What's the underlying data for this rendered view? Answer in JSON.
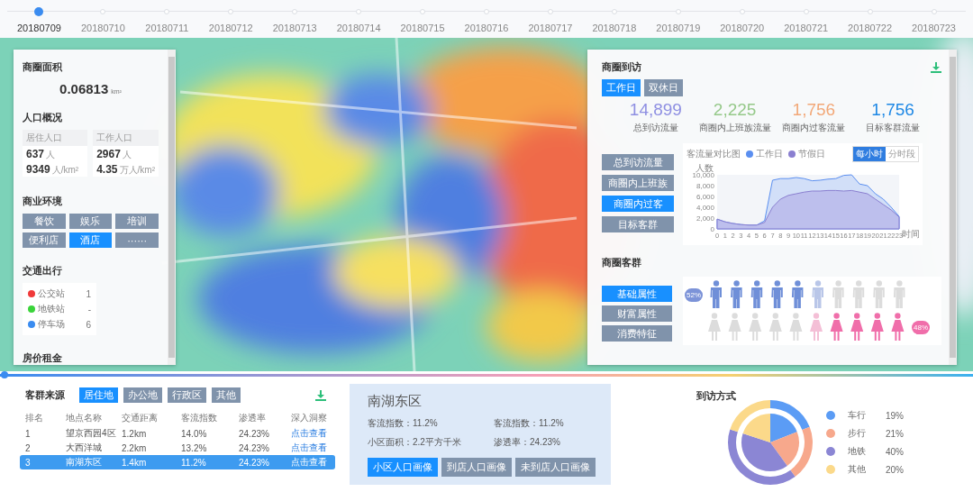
{
  "timeline": {
    "dates": [
      {
        "label": "20180709",
        "selected": true
      },
      {
        "label": "20180710",
        "selected": false
      },
      {
        "label": "20180711",
        "selected": false
      },
      {
        "label": "20180712",
        "selected": false
      },
      {
        "label": "20180713",
        "selected": false
      },
      {
        "label": "20180714",
        "selected": false
      },
      {
        "label": "20180715",
        "selected": false
      },
      {
        "label": "20180716",
        "selected": false
      },
      {
        "label": "20180717",
        "selected": false
      },
      {
        "label": "20180718",
        "selected": false
      },
      {
        "label": "20180719",
        "selected": false
      },
      {
        "label": "20180720",
        "selected": false
      },
      {
        "label": "20180721",
        "selected": false
      },
      {
        "label": "20180722",
        "selected": false
      },
      {
        "label": "20180723",
        "selected": false
      }
    ]
  },
  "area_panel": {
    "title": "商圈面积",
    "value": "0.06813",
    "unit": "km²",
    "population": {
      "title": "人口概况",
      "cards": [
        {
          "label": "居住人口",
          "count": "637",
          "count_unit": "人",
          "density": "9349",
          "density_unit": "人/km²"
        },
        {
          "label": "工作人口",
          "count": "2967",
          "count_unit": "人",
          "density": "4.35",
          "density_unit": "万人/km²"
        }
      ]
    },
    "business": {
      "title": "商业环境",
      "tags": [
        {
          "label": "餐饮",
          "selected": false
        },
        {
          "label": "娱乐",
          "selected": false
        },
        {
          "label": "培训",
          "selected": false
        },
        {
          "label": "便利店",
          "selected": false
        },
        {
          "label": "酒店",
          "selected": true
        },
        {
          "label": "······",
          "selected": false
        }
      ]
    },
    "transport": {
      "title": "交通出行",
      "items": [
        {
          "label": "公交站",
          "count": "1",
          "color": "#f03a3a"
        },
        {
          "label": "地铁站",
          "count": "-",
          "color": "#3ad43a"
        },
        {
          "label": "停车场",
          "count": "6",
          "color": "#3a8cf0"
        }
      ]
    },
    "housing": {
      "title": "房价租金"
    }
  },
  "visit_panel": {
    "title": "商圈到访",
    "day_tabs": [
      {
        "label": "工作日",
        "selected": true
      },
      {
        "label": "双休日",
        "selected": false
      }
    ],
    "stats": [
      {
        "value": "14,899",
        "label": "总到访流量",
        "color": "#8e8fe2"
      },
      {
        "value": "2,225",
        "label": "商圈内上班族流量",
        "color": "#96c98a"
      },
      {
        "value": "1,756",
        "label": "商圈内过客流量",
        "color": "#f2a878"
      },
      {
        "value": "1,756",
        "label": "目标客群流量",
        "color": "#1e88e5"
      }
    ],
    "flow_buttons": [
      {
        "label": "总到访流量",
        "selected": false
      },
      {
        "label": "商圈内上班族",
        "selected": false
      },
      {
        "label": "商圈内过客",
        "selected": true
      },
      {
        "label": "目标客群",
        "selected": false
      }
    ],
    "chart": {
      "modes": [
        {
          "label": "每小时",
          "selected": true
        },
        {
          "label": "分时段",
          "selected": false
        }
      ],
      "chart_data": {
        "type": "area",
        "title": "客流量对比图",
        "xlabel": "时间",
        "ylabel": "人数",
        "x": [
          0,
          1,
          2,
          3,
          4,
          5,
          6,
          7,
          8,
          9,
          10,
          11,
          12,
          13,
          14,
          15,
          16,
          17,
          18,
          19,
          20,
          21,
          22,
          23
        ],
        "series": [
          {
            "name": "工作日",
            "color": "#5b8ff0",
            "values": [
              1800,
              1300,
              1000,
              800,
              700,
              700,
              1500,
              9000,
              9300,
              9300,
              9500,
              9300,
              8900,
              9000,
              9200,
              9300,
              9900,
              10000,
              8300,
              8000,
              6500,
              5500,
              4000,
              2300
            ]
          },
          {
            "name": "节假日",
            "color": "#8a7fd0",
            "values": [
              1800,
              1300,
              1000,
              800,
              700,
              700,
              1200,
              4000,
              5500,
              6200,
              6500,
              6800,
              7000,
              7000,
              7100,
              7100,
              7000,
              7100,
              6800,
              6500,
              5500,
              4500,
              3500,
              2200
            ]
          }
        ],
        "xlim": [
          0,
          23
        ],
        "ylim": [
          0,
          10000
        ],
        "yticks": [
          {
            "value": 0,
            "label": "0"
          },
          {
            "value": 2000,
            "label": "2,000"
          },
          {
            "value": 4000,
            "label": "4,000"
          },
          {
            "value": 6000,
            "label": "6,000"
          },
          {
            "value": 8000,
            "label": "8,000"
          },
          {
            "value": 10000,
            "label": "10,000"
          }
        ],
        "xticks": [
          0,
          1,
          2,
          3,
          4,
          5,
          6,
          7,
          8,
          9,
          10,
          11,
          12,
          13,
          14,
          15,
          16,
          17,
          18,
          19,
          20,
          21,
          22,
          23
        ]
      }
    },
    "crowd": {
      "title": "商圈客群",
      "buttons": [
        {
          "label": "基础属性",
          "selected": true
        },
        {
          "label": "财富属性",
          "selected": false
        },
        {
          "label": "消费特征",
          "selected": false
        }
      ],
      "male": {
        "badge": "52%",
        "figures": [
          {
            "kind": "full"
          },
          {
            "kind": "full"
          },
          {
            "kind": "full"
          },
          {
            "kind": "full"
          },
          {
            "kind": "full"
          },
          {
            "kind": "faded"
          },
          {
            "kind": "empty"
          },
          {
            "kind": "empty"
          },
          {
            "kind": "empty"
          },
          {
            "kind": "empty"
          }
        ]
      },
      "female": {
        "badge": "48%",
        "figures": [
          {
            "kind": "empty"
          },
          {
            "kind": "empty"
          },
          {
            "kind": "empty"
          },
          {
            "kind": "empty"
          },
          {
            "kind": "empty"
          },
          {
            "kind": "faded"
          },
          {
            "kind": "full"
          },
          {
            "kind": "full"
          },
          {
            "kind": "full"
          },
          {
            "kind": "full"
          }
        ]
      }
    }
  },
  "source": {
    "title": "客群来源",
    "tabs": [
      {
        "label": "居住地",
        "selected": true
      },
      {
        "label": "办公地",
        "selected": false
      },
      {
        "label": "行政区",
        "selected": false
      },
      {
        "label": "其他",
        "selected": false
      }
    ],
    "table": {
      "columns": [
        "排名",
        "地点名称",
        "交通距离",
        "客流指数",
        "渗透率",
        "深入洞察"
      ],
      "rows": [
        {
          "cells": [
            "1",
            "望京西园4区",
            "1.2km",
            "14.0%",
            "24.23%"
          ],
          "link": "点击查看",
          "selected": false
        },
        {
          "cells": [
            "2",
            "大西洋城",
            "2.2km",
            "13.2%",
            "24.23%"
          ],
          "link": "点击查看",
          "selected": false
        },
        {
          "cells": [
            "3",
            "南湖东区",
            "1.4km",
            "11.2%",
            "24.23%"
          ],
          "link": "点击查看",
          "selected": true
        }
      ]
    }
  },
  "popup": {
    "title": "南湖东区",
    "facts": [
      "客流指数：11.2%",
      "客流指数：11.2%",
      "小区面积：2.2平方千米",
      "渗透率：24.23%"
    ],
    "buttons": [
      {
        "label": "小区人口画像",
        "selected": true
      },
      {
        "label": "到店人口画像",
        "selected": false
      },
      {
        "label": "未到店人口画像",
        "selected": false
      }
    ]
  },
  "visit_mode": {
    "chart_data": {
      "type": "donut",
      "title": "到访方式",
      "categories": [
        "车行",
        "步行",
        "地铁",
        "其他"
      ],
      "legend": "right",
      "series": [
        {
          "values": [
            19,
            21,
            40,
            20
          ]
        },
        {
          "values": [
            19,
            21,
            40,
            20
          ]
        }
      ],
      "value_labels": [
        "19%",
        "21%",
        "40%",
        "20%"
      ],
      "colors": [
        "#5b9cf5",
        "#f7a88c",
        "#8b86d4",
        "#fbd98a"
      ]
    }
  }
}
